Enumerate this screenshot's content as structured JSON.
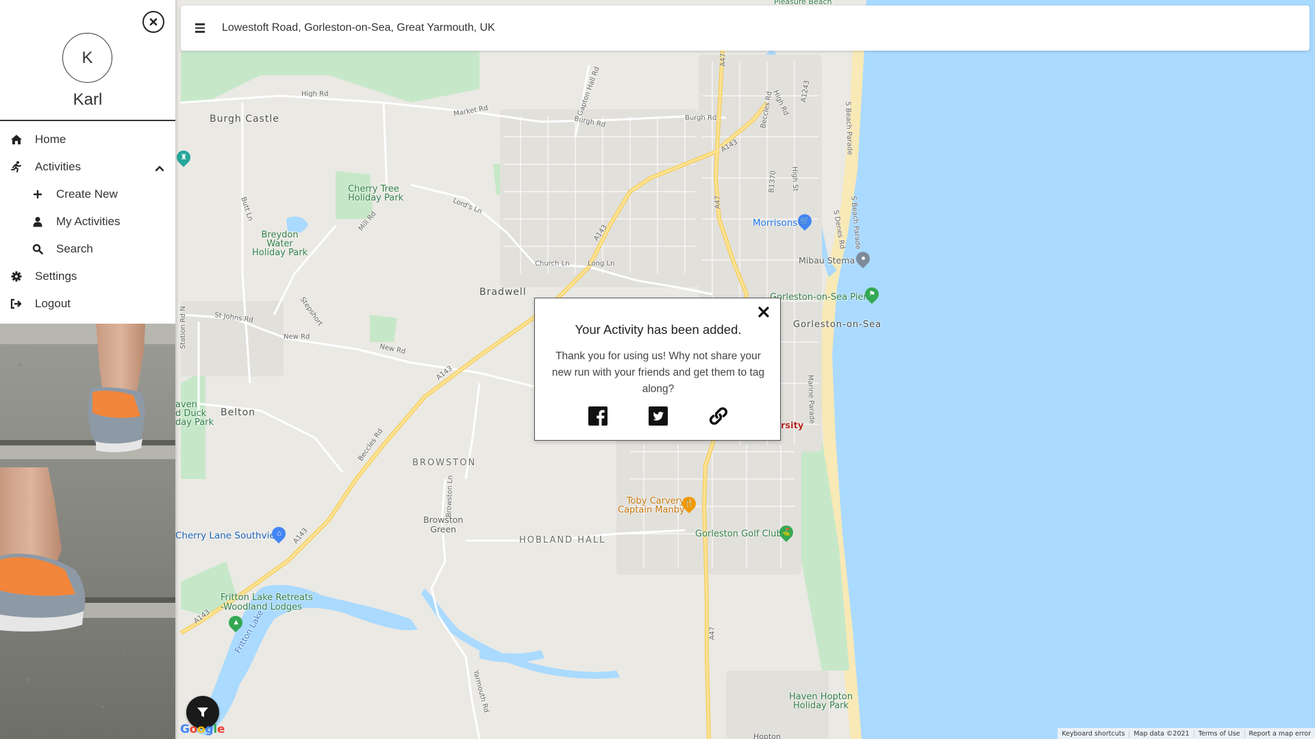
{
  "search": {
    "value": "Lowestoft Road, Gorleston-on-Sea, Great Yarmouth, UK"
  },
  "user": {
    "initial": "K",
    "name": "Karl"
  },
  "nav": {
    "home": "Home",
    "activities": "Activities",
    "create_new": "Create New",
    "my_activities": "My Activities",
    "search": "Search",
    "settings": "Settings",
    "logout": "Logout"
  },
  "modal": {
    "title": "Your Activity has been added.",
    "body": "Thank you for using us! Why not share your new run with your friends and get them to tag along?",
    "share_icons": [
      "facebook-icon",
      "twitter-icon",
      "link-icon"
    ]
  },
  "map": {
    "places": {
      "burgh_castle": "Burgh Castle",
      "cherry_tree": "Cherry Tree\nHoliday Park",
      "breydon": "Breydon\nWater\nHoliday Park",
      "bradwell": "Bradwell",
      "belton": "Belton",
      "browston": "BROWSTON",
      "browston_green": "Browston\nGreen",
      "hobland_hall": "HOBLAND HALL",
      "gorleston": "Gorleston-on-Sea",
      "haven_duck": "aven\nd Duck\nday Park",
      "cherry_lane": "Cherry Lane Southview",
      "fritton_lodges": "Fritton Lake Retreats\n-Woodland Lodges",
      "fritton_lake": "Fritton Lake",
      "toby": "Toby Carvery\nCaptain Manby",
      "golf_club": "Gorleston Golf Club",
      "morrisons": "Morrisons",
      "mibau": "Mibau Stema",
      "pier": "Gorleston-on-Sea Pier",
      "haven_hopton": "Haven Hopton\nHoliday Park",
      "rsity": "rsity",
      "hopton": "Hopton"
    },
    "roads": {
      "high_rd": "High Rd",
      "market_rd": "Market Rd",
      "burgh_rd1": "Burgh Rd",
      "burgh_rd2": "Burgh Rd",
      "a47_top": "A47",
      "a47_mid": "A47",
      "a47_bottom": "A47",
      "a143_1": "A143",
      "a143_2": "A143",
      "a143_3": "A143",
      "a143_4": "A143",
      "a143_5": "A143",
      "a1243": "A1243",
      "b1370": "B1370",
      "lords_ln": "Lord's Ln",
      "mill_rd": "Mill Rd",
      "butt_ln": "Butt Ln",
      "church_ln": "Church Ln",
      "long_ln": "Long Ln",
      "st_johns": "St Johns Rd",
      "new_rd1": "New Rd",
      "new_rd2": "New Rd",
      "station_rd": "Station Rd N",
      "stepshort": "Stepshort",
      "beccles_rd": "Beccles Rd",
      "beccles_rd2": "Beccles Rd",
      "browston_ln": "Browston Ln",
      "yarmouth_rd": "Yarmouth Rd",
      "marine_parade": "Marine Parade",
      "s_beach_parade1": "S Beach Parade",
      "s_beach_parade2": "S Beach Parade",
      "s_denes_rd": "S Denes Rd",
      "high_st": "High St",
      "gapton_hall": "Gapton Hall Rd",
      "beccles_high": "High Rd",
      "pleasure_beach": "Pleasure Beach"
    }
  },
  "google_logo": "Google",
  "attribution": {
    "shortcuts": "Keyboard shortcuts",
    "map_data": "Map data ©2021",
    "terms": "Terms of Use",
    "report": "Report a map error"
  },
  "colors": {
    "sea": "#aadaff",
    "land": "#ebe9e4",
    "park": "#c6e8c9",
    "road_major": "#fde293",
    "beach": "#f8e9b6"
  }
}
